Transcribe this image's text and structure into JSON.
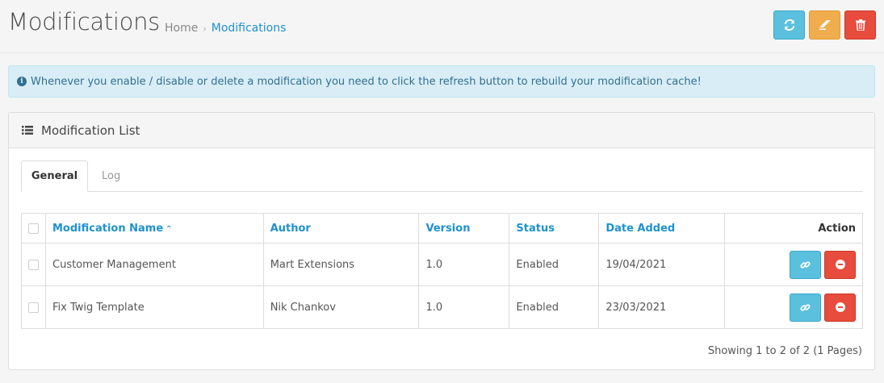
{
  "header": {
    "title": "Modifications",
    "breadcrumb": {
      "home": "Home",
      "separator": "›",
      "current": "Modifications"
    },
    "buttons": [
      {
        "name": "refresh",
        "icon": "refresh-icon",
        "color": "#5bc0de"
      },
      {
        "name": "clear",
        "icon": "eraser-icon",
        "color": "#f0ad4e"
      },
      {
        "name": "delete",
        "icon": "trash-icon",
        "color": "#e74c3c"
      }
    ]
  },
  "alert": {
    "icon": "info-circle-icon",
    "text": "Whenever you enable / disable or delete a modification you need to click the refresh button to rebuild your modification cache!"
  },
  "panel": {
    "icon": "list-icon",
    "title": "Modification List",
    "tabs": [
      {
        "label": "General",
        "active": true
      },
      {
        "label": "Log",
        "active": false
      }
    ],
    "table": {
      "columns": {
        "name": "Modification Name",
        "author": "Author",
        "version": "Version",
        "status": "Status",
        "date_added": "Date Added",
        "action": "Action"
      },
      "sort_indicator": "^",
      "rows": [
        {
          "name": "Customer Management",
          "author": "Mart Extensions",
          "version": "1.0",
          "status": "Enabled",
          "date_added": "19/04/2021"
        },
        {
          "name": "Fix Twig Template",
          "author": "Nik Chankov",
          "version": "1.0",
          "status": "Enabled",
          "date_added": "23/03/2021"
        }
      ]
    },
    "pagination_info": "Showing 1 to 2 of 2 (1 Pages)"
  },
  "colors": {
    "link": "#1e91cf",
    "info_bg": "#d9edf7",
    "info_text": "#31708f",
    "danger": "#e74c3c",
    "warning": "#f0ad4e",
    "info_button": "#5bc0de"
  }
}
